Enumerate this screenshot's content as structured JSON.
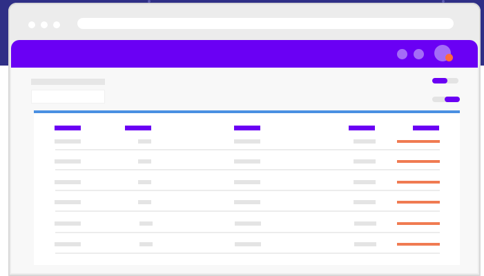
{
  "window": {
    "controls": [
      "close-dot",
      "minimize-dot",
      "maximize-dot"
    ],
    "address_bar": ""
  },
  "app": {
    "header": {
      "actions": [
        "notification-icon",
        "message-icon"
      ],
      "avatar": "avatar-icon",
      "avatar_badge": "status-badge"
    },
    "title": "",
    "search": {
      "value": "",
      "placeholder": ""
    },
    "toggles": [
      {
        "name": "toggle-filter-a",
        "on": false
      },
      {
        "name": "toggle-filter-b",
        "on": true
      }
    ],
    "table": {
      "columns": [
        "",
        "",
        "",
        "",
        ""
      ],
      "rows": [
        [
          "",
          "",
          "",
          "",
          ""
        ],
        [
          "",
          "",
          "",
          "",
          ""
        ],
        [
          "",
          "",
          "",
          "",
          ""
        ],
        [
          "",
          "",
          "",
          "",
          ""
        ],
        [
          "",
          "",
          "",
          "",
          ""
        ],
        [
          "",
          "",
          "",
          "",
          ""
        ]
      ]
    }
  },
  "colors": {
    "background": "#2f2f86",
    "brand": "#6a00f4",
    "brand_light": "#a46cf7",
    "accent": "#f07b52",
    "badge": "#ff6a3d",
    "table_border": "#4a90e2"
  }
}
